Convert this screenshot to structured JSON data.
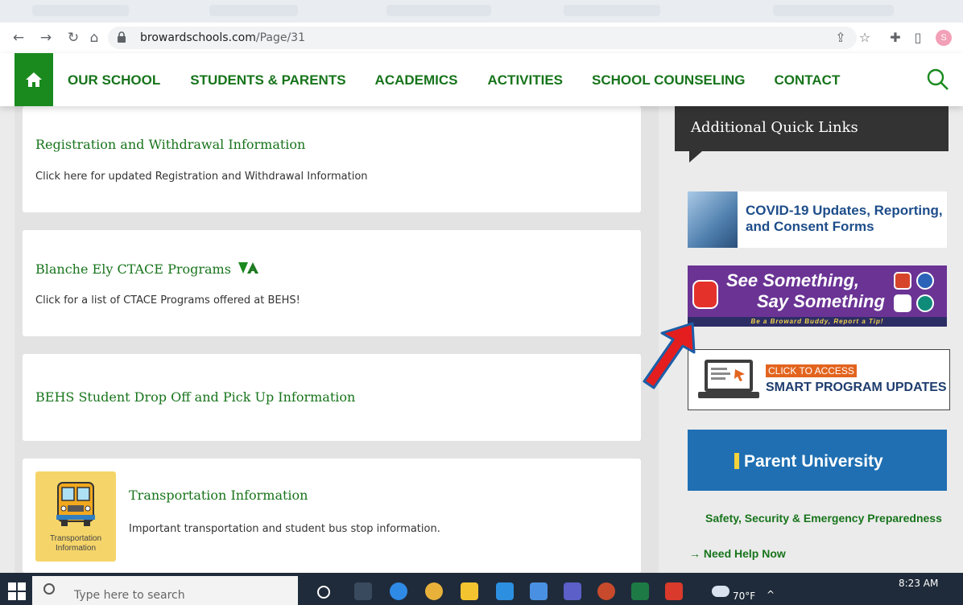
{
  "browser": {
    "url_domain": "browardschools.com",
    "url_path": "/Page/31"
  },
  "site_nav": {
    "items": [
      "OUR SCHOOL",
      "STUDENTS & PARENTS",
      "ACADEMICS",
      "ACTIVITIES",
      "SCHOOL COUNSELING",
      "CONTACT"
    ]
  },
  "main": {
    "cards": [
      {
        "title": "Registration and Withdrawal Information",
        "desc": "Click here for updated Registration and Withdrawal Information"
      },
      {
        "title": "Blanche Ely CTACE Programs",
        "desc": "Click for a list of CTACE Programs offered at BEHS!"
      },
      {
        "title": "BEHS Student Drop Off and Pick Up Information",
        "desc": ""
      },
      {
        "title": "Transportation Information",
        "desc": "Important transportation and student bus stop information."
      }
    ],
    "bus_label_1": "Transportation",
    "bus_label_2": "Information"
  },
  "sidebar": {
    "header": "Additional Quick Links",
    "covid_line1": "COVID-19 Updates, Reporting,",
    "covid_line2": "and Consent Forms",
    "see_line1": "See Something,",
    "see_line2": "Say Something",
    "see_tagline": "Be a Broward Buddy, Report a Tip!",
    "smart_click": "CLICK TO ACCESS",
    "smart_updates": "SMART PROGRAM UPDATES",
    "parent_university": "Parent University",
    "safety_link": "Safety, Security & Emergency Preparedness",
    "need_help_link": "→ Need Help Now"
  },
  "taskbar": {
    "search_placeholder": "Type here to search",
    "weather": "70°F",
    "time": "8:23 AM"
  },
  "colors": {
    "brand_green": "#17741b",
    "home_tile": "#1a8a1e",
    "arrow_red": "#e41e1e",
    "arrow_outline": "#1b5ea8"
  }
}
